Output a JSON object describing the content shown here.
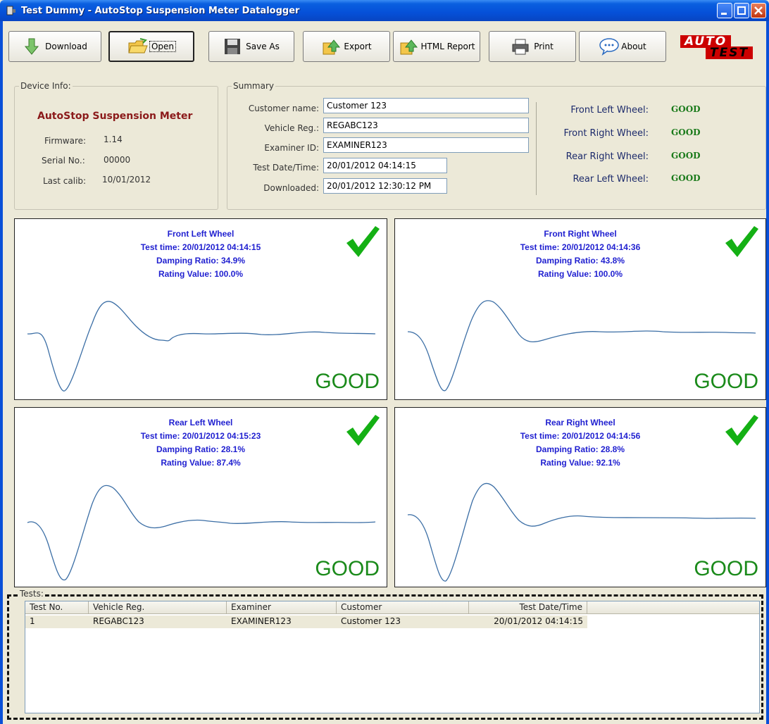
{
  "window": {
    "title": "Test Dummy - AutoStop Suspension Meter Datalogger"
  },
  "toolbar": {
    "download_label": "Download",
    "open_label": "Open",
    "save_as_label": "Save As",
    "export_label": "Export",
    "html_report_label": "HTML Report",
    "print_label": "Print",
    "about_label": "About"
  },
  "logo": {
    "line1": "AUTO",
    "line2": "TEST"
  },
  "device_info": {
    "legend": "Device Info:",
    "title": "AutoStop Suspension Meter",
    "firmware_label": "Firmware:",
    "firmware": "1.14",
    "serial_label": "Serial No.:",
    "serial": "00000",
    "calib_label": "Last calib:",
    "calib": "10/01/2012"
  },
  "summary": {
    "legend": "Summary",
    "customer_label": "Customer name:",
    "customer": "Customer 123",
    "vehicle_label": "Vehicle Reg.:",
    "vehicle": "REGABC123",
    "examiner_label": "Examiner ID:",
    "examiner": "EXAMINER123",
    "test_dt_label": "Test Date/Time:",
    "test_dt": "20/01/2012 04:14:15",
    "downloaded_label": "Downloaded:",
    "downloaded": "20/01/2012 12:30:12 PM",
    "wheels": [
      {
        "label": "Front Left Wheel:",
        "status": "GOOD"
      },
      {
        "label": "Front Right Wheel:",
        "status": "GOOD"
      },
      {
        "label": "Rear Right Wheel:",
        "status": "GOOD"
      },
      {
        "label": "Rear Left Wheel:",
        "status": "GOOD"
      }
    ]
  },
  "panels": [
    {
      "name": "Front Left Wheel",
      "time": "Test time: 20/01/2012 04:14:15",
      "damping": "Damping Ratio: 34.9%",
      "rating": "Rating Value: 100.0%",
      "result": "GOOD"
    },
    {
      "name": "Front Right Wheel",
      "time": "Test time: 20/01/2012 04:14:36",
      "damping": "Damping Ratio: 43.8%",
      "rating": "Rating Value: 100.0%",
      "result": "GOOD"
    },
    {
      "name": "Rear Left Wheel",
      "time": "Test time: 20/01/2012 04:15:23",
      "damping": "Damping Ratio: 28.1%",
      "rating": "Rating Value: 87.4%",
      "result": "GOOD"
    },
    {
      "name": "Rear Right Wheel",
      "time": "Test time: 20/01/2012 04:14:56",
      "damping": "Damping Ratio: 28.8%",
      "rating": "Rating Value: 92.1%",
      "result": "GOOD"
    }
  ],
  "tests": {
    "legend": "Tests:",
    "columns": [
      "Test No.",
      "Vehicle Reg.",
      "Examiner",
      "Customer",
      "Test Date/Time"
    ],
    "rows": [
      [
        "1",
        "REGABC123",
        "EXAMINER123",
        "Customer 123",
        "20/01/2012 04:14:15"
      ]
    ]
  },
  "colors": {
    "title_bar": "#0550d8",
    "good_green": "#1a8a1a",
    "panel_text_blue": "#1f1fd0",
    "device_title_red": "#8b1a1a",
    "waveform": "#3b6ea5"
  },
  "icons": {
    "download": "down-arrow-icon",
    "open": "folder-icon",
    "save_as": "floppy-disk-icon",
    "export": "export-arrow-icon",
    "html_report": "report-arrow-icon",
    "print": "printer-icon",
    "about": "speech-bubble-icon",
    "result": "checkmark-icon"
  }
}
